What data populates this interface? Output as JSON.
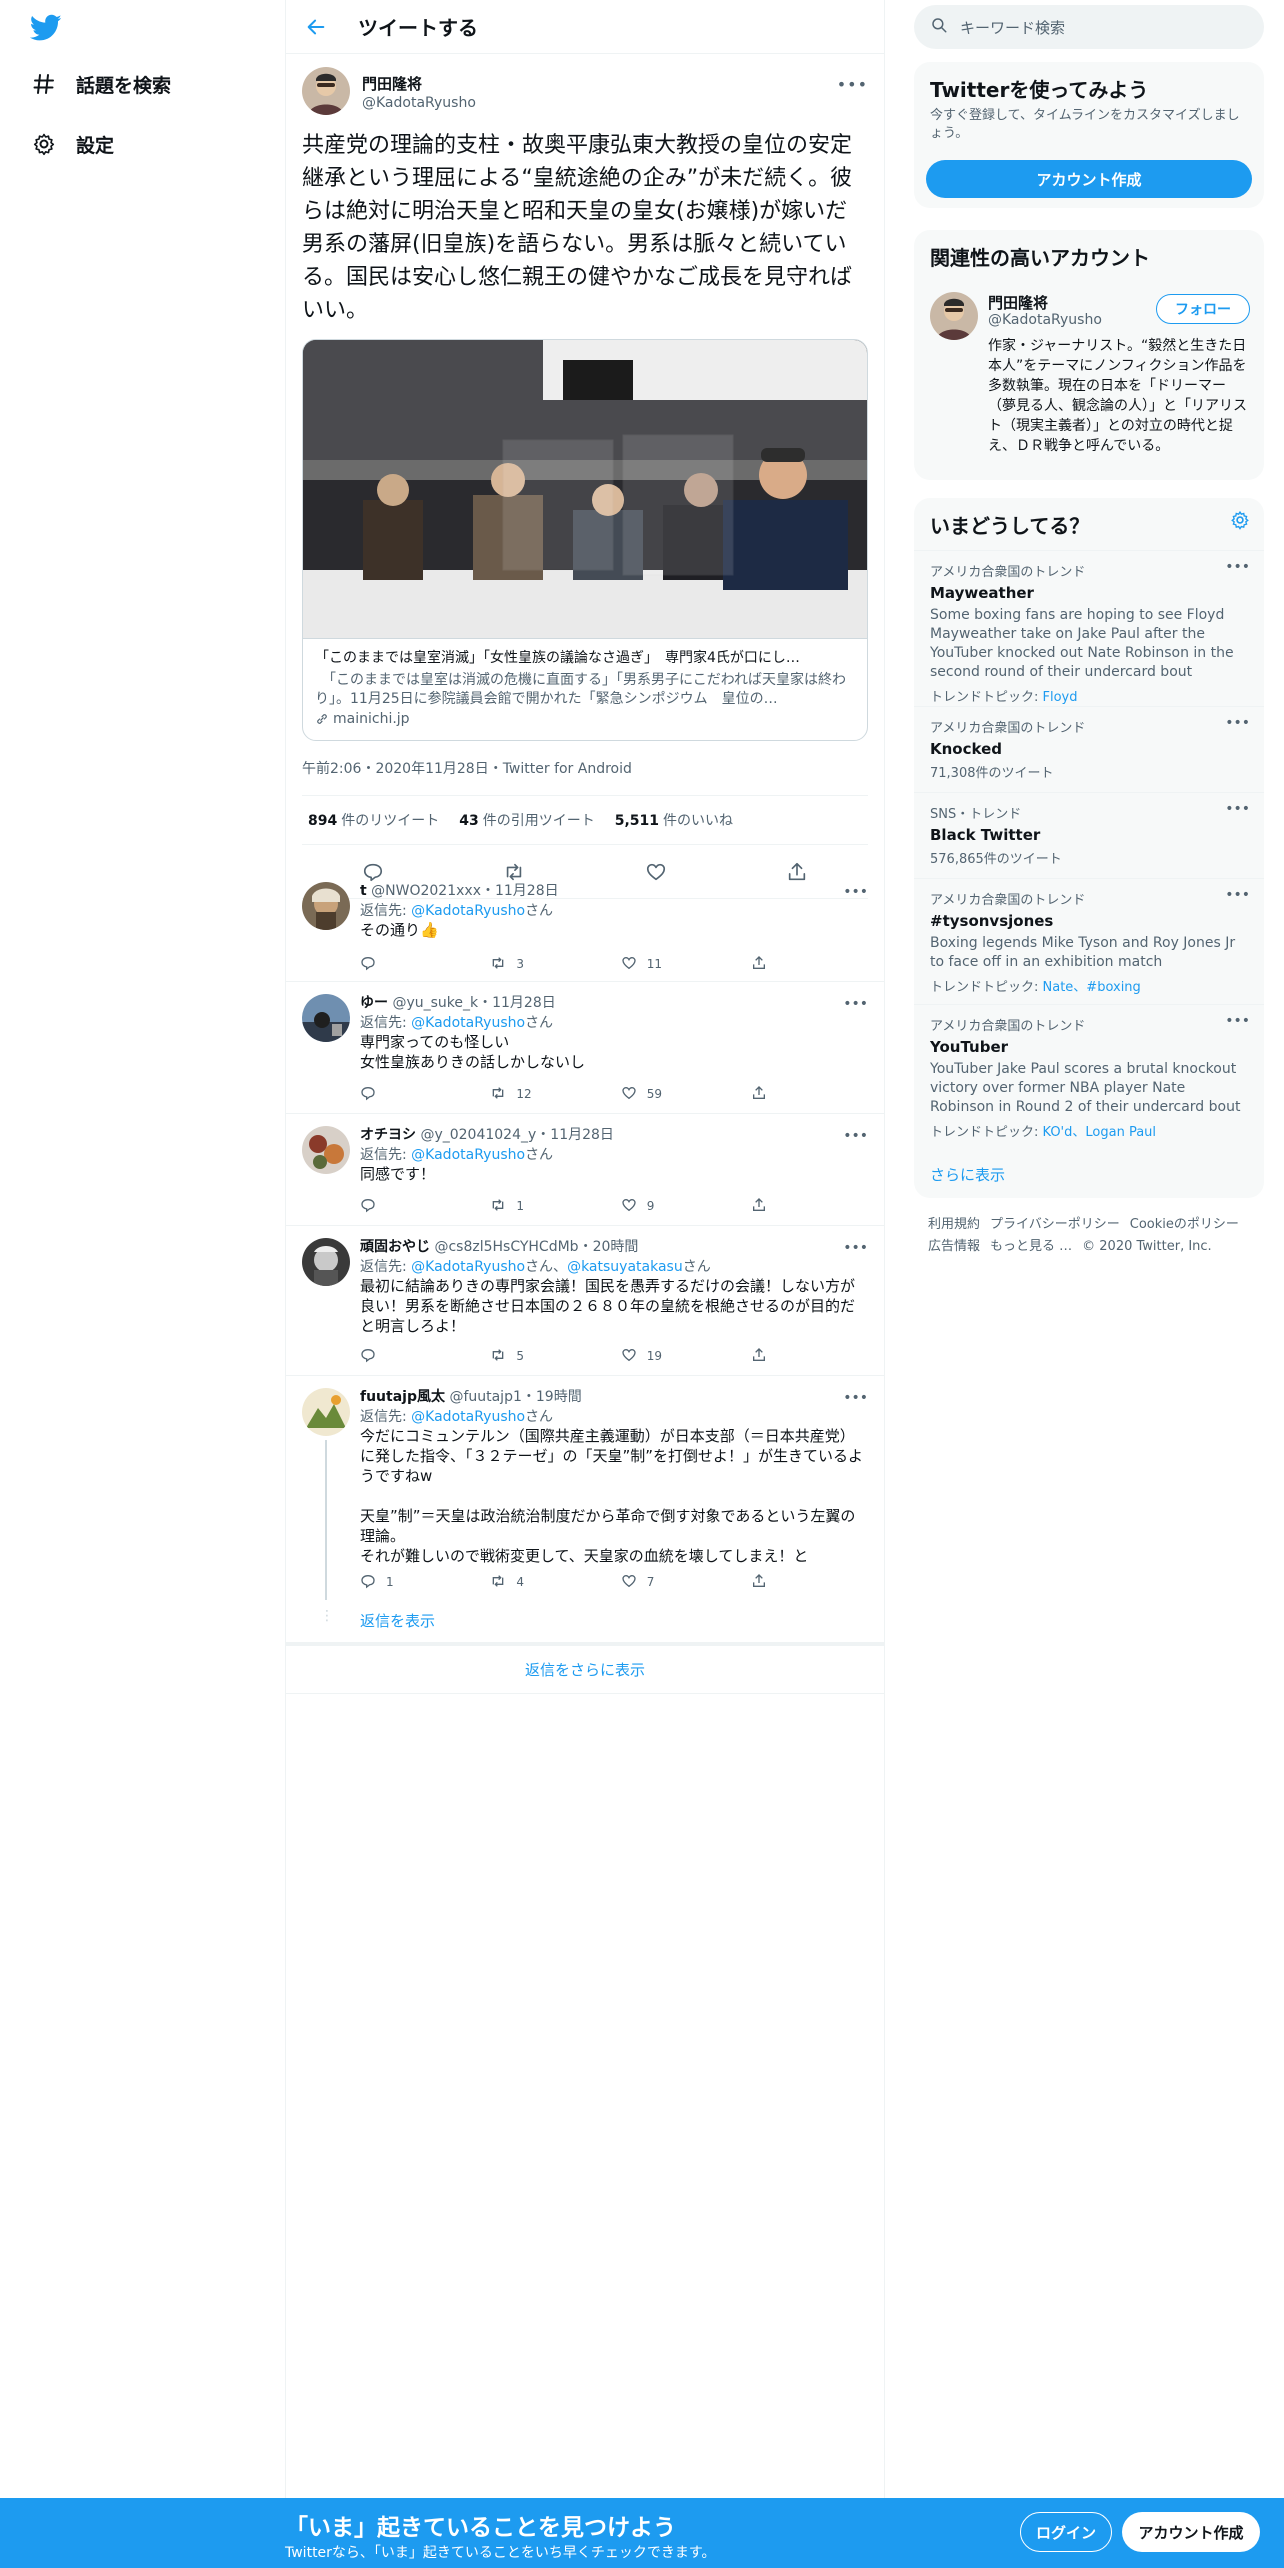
{
  "nav": {
    "logo": "twitter-bird-icon",
    "explore_label": "話題を検索",
    "settings_label": "設定"
  },
  "header": {
    "title": "ツイートする"
  },
  "main_tweet": {
    "name": "門田隆将",
    "handle": "@KadotaRyusho",
    "text": "共産党の理論的支柱・故奥平康弘東大教授の皇位の安定継承という理屈による“皇統途絶の企み”が未だ続く。彼らは絶対に明治天皇と昭和天皇の皇女(お嬢様)が嫁いだ男系の藩屏(旧皇族)を語らない。男系は脈々と続いている。国民は安心し悠仁親王の健やかなご成長を見守ればいい。",
    "card_title": "「このままでは皇室消滅」「女性皇族の議論なさ過ぎ」　専門家4氏が口にし…",
    "card_desc": "　「このままでは皇室は消滅の危機に直面する」「男系男子にこだわれば天皇家は終わり」。11月25日に参院議員会館で開かれた「緊急シンポジウム　皇位の…",
    "card_domain": "mainichi.jp",
    "timestamp": "午前2:06・2020年11月28日・Twitter for Android",
    "retweets_num": "894",
    "retweets_label": "件のリツイート",
    "quotes_num": "43",
    "quotes_label": "件の引用ツイート",
    "likes_num": "5,511",
    "likes_label": "件のいいね"
  },
  "replies": [
    {
      "name": "t",
      "handle": "@NWO2021xxx",
      "time": "11月28日",
      "replyto_prefix": "返信先: ",
      "replyto": "@KadotaRyusho",
      "replyto_suffix": "さん",
      "text": "その通り👍",
      "retweets": "3",
      "likes": "11"
    },
    {
      "name": "ゆー",
      "handle": "@yu_suke_k",
      "time": "11月28日",
      "replyto_prefix": "返信先: ",
      "replyto": "@KadotaRyusho",
      "replyto_suffix": "さん",
      "text": "専門家ってのも怪しい\n女性皇族ありきの話しかしないし",
      "retweets": "12",
      "likes": "59"
    },
    {
      "name": "オチヨシ",
      "handle": "@y_02041024_y",
      "time": "11月28日",
      "replyto_prefix": "返信先: ",
      "replyto": "@KadotaRyusho",
      "replyto_suffix": "さん",
      "text": "同感です！",
      "retweets": "1",
      "likes": "9"
    },
    {
      "name": "頑固おやじ",
      "handle": "@cs8zl5HsCYHCdMb",
      "time": "20時間",
      "replyto_prefix": "返信先: ",
      "replyto": "@KadotaRyusho",
      "replyto_mid": "さん、",
      "replyto2": "@katsuyatakasu",
      "replyto_suffix": "さん",
      "text": "最初に結論ありきの専門家会議！国民を愚弄するだけの会議！しない方が良い！男系を断絶させ日本国の２６８０年の皇統を根絶させるのが目的だと明言しろよ！",
      "retweets": "5",
      "likes": "19"
    },
    {
      "name": "fuutajp風太",
      "handle": "@fuutajp1",
      "time": "19時間",
      "replyto_prefix": "返信先: ",
      "replyto": "@KadotaRyusho",
      "replyto_suffix": "さん",
      "text": "今だにコミュンテルン（国際共産主義運動）が日本支部（＝日本共産党）に発した指令、「３２テーゼ」の「天皇”制”を打倒せよ！」が生きているようですねw\n\n天皇”制”＝天皇は政治統治制度だから革命で倒す対象であるという左翼の理論。\nそれが難しいので戦術変更して、天皇家の血統を壊してしまえ！と",
      "replies": "1",
      "retweets": "4",
      "likes": "7"
    }
  ],
  "show_replies_label": "返信を表示",
  "more_replies_label": "返信をさらに表示",
  "sidebar": {
    "search_placeholder": "キーワード検索",
    "signup_title": "Twitterを使ってみよう",
    "signup_sub": "今すぐ登録して、タイムラインをカスタマイズしましょう。",
    "signup_button": "アカウント作成",
    "related_title": "関連性の高いアカウント",
    "related_name": "門田隆将",
    "related_handle": "@KadotaRyusho",
    "follow_label": "フォロー",
    "related_bio": "作家・ジャーナリスト。“毅然と生きた日本人”をテーマにノンフィクション作品を多数執筆。現在の日本を「ドリーマー（夢見る人、観念論の人）」と「リアリスト（現実主義者）」との対立の時代と捉え、ＤＲ戦争と呼んでいる。",
    "trends_title": "いまどうしてる？",
    "trends": [
      {
        "context": "アメリカ合衆国のトレンド",
        "name": "Mayweather",
        "desc": "Some boxing fans are hoping to see Floyd Mayweather take on Jake Paul after the YouTuber knocked out Nate Robinson in the second round of their undercard bout",
        "topic_label": "トレンドトピック: ",
        "topics": "Floyd"
      },
      {
        "context": "アメリカ合衆国のトレンド",
        "name": "Knocked",
        "count": "71,308件のツイート"
      },
      {
        "context": "SNS・トレンド",
        "name": "Black Twitter",
        "count": "576,865件のツイート"
      },
      {
        "context": "アメリカ合衆国のトレンド",
        "name": "#tysonvsjones",
        "desc": "Boxing legends Mike Tyson and Roy Jones Jr to face off in an exhibition match",
        "topic_label": "トレンドトピック: ",
        "topics": "Nate、#boxing"
      },
      {
        "context": "アメリカ合衆国のトレンド",
        "name": "YouTuber",
        "desc": "YouTuber Jake Paul scores a brutal knockout victory over former NBA player Nate Robinson in Round 2 of their undercard bout",
        "topic_label": "トレンドトピック: ",
        "topics": "KO'd、Logan Paul"
      }
    ],
    "show_more": "さらに表示",
    "footer_line1": [
      "利用規約",
      "プライバシーポリシー",
      "Cookieのポリシー"
    ],
    "footer_line2": [
      "広告情報",
      "もっと見る …",
      "© 2020 Twitter, Inc."
    ]
  },
  "bottom_bar": {
    "title": "「いま」起きていることを見つけよう",
    "sub": "Twitterなら、「いま」起きていることをいち早くチェックできます。",
    "login": "ログイン",
    "signup": "アカウント作成"
  },
  "colors": {
    "accent": "#1d9bf0",
    "text": "#0f1419",
    "muted": "#536471"
  }
}
